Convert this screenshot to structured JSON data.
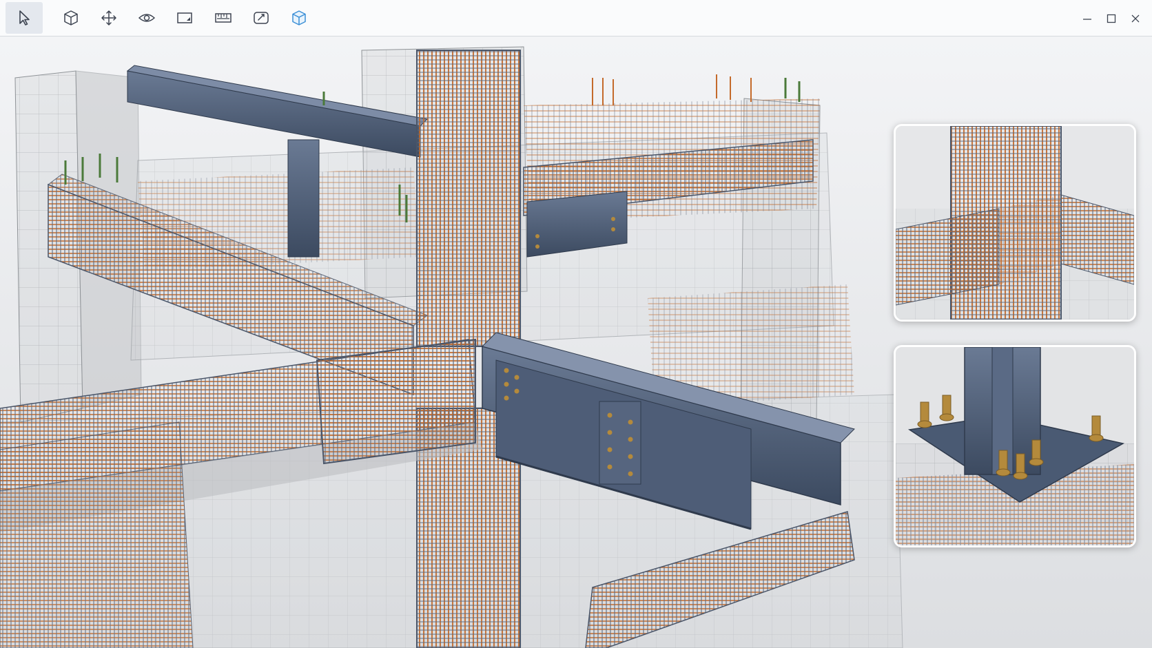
{
  "toolbar": {
    "tools": [
      {
        "name": "select-tool",
        "icon": "cursor-arrow-icon",
        "active": true
      },
      {
        "name": "3d-view-tool",
        "icon": "cube-icon",
        "active": false
      },
      {
        "name": "move-tool",
        "icon": "move-arrows-icon",
        "active": false
      },
      {
        "name": "visibility-tool",
        "icon": "eye-icon",
        "active": false
      },
      {
        "name": "section-plane-tool",
        "icon": "section-plane-icon",
        "active": false
      },
      {
        "name": "measure-tool",
        "icon": "ruler-icon",
        "active": false
      },
      {
        "name": "annotate-tool",
        "icon": "annotation-icon",
        "active": false
      },
      {
        "name": "model-tool",
        "icon": "blue-cube-icon",
        "active": false
      }
    ],
    "window_controls": [
      "minimize-icon",
      "maximize-icon",
      "close-icon"
    ]
  },
  "viewport": {
    "scene": "3d-structural-model-rebar-and-steel-beam-connection",
    "insets": [
      {
        "name": "detail-inset-column-beam-joint"
      },
      {
        "name": "detail-inset-column-base-plate"
      }
    ]
  },
  "colors": {
    "toolbar_bg": "#fafbfc",
    "icon": "#3c4350",
    "accent_blue": "#3b8fd6",
    "steel": "#4a5a73",
    "rebar": "#c46a2a",
    "stirrup": "#5d6b80",
    "concrete": "#c8cacd",
    "anchor_bolt": "#b48a3c"
  }
}
